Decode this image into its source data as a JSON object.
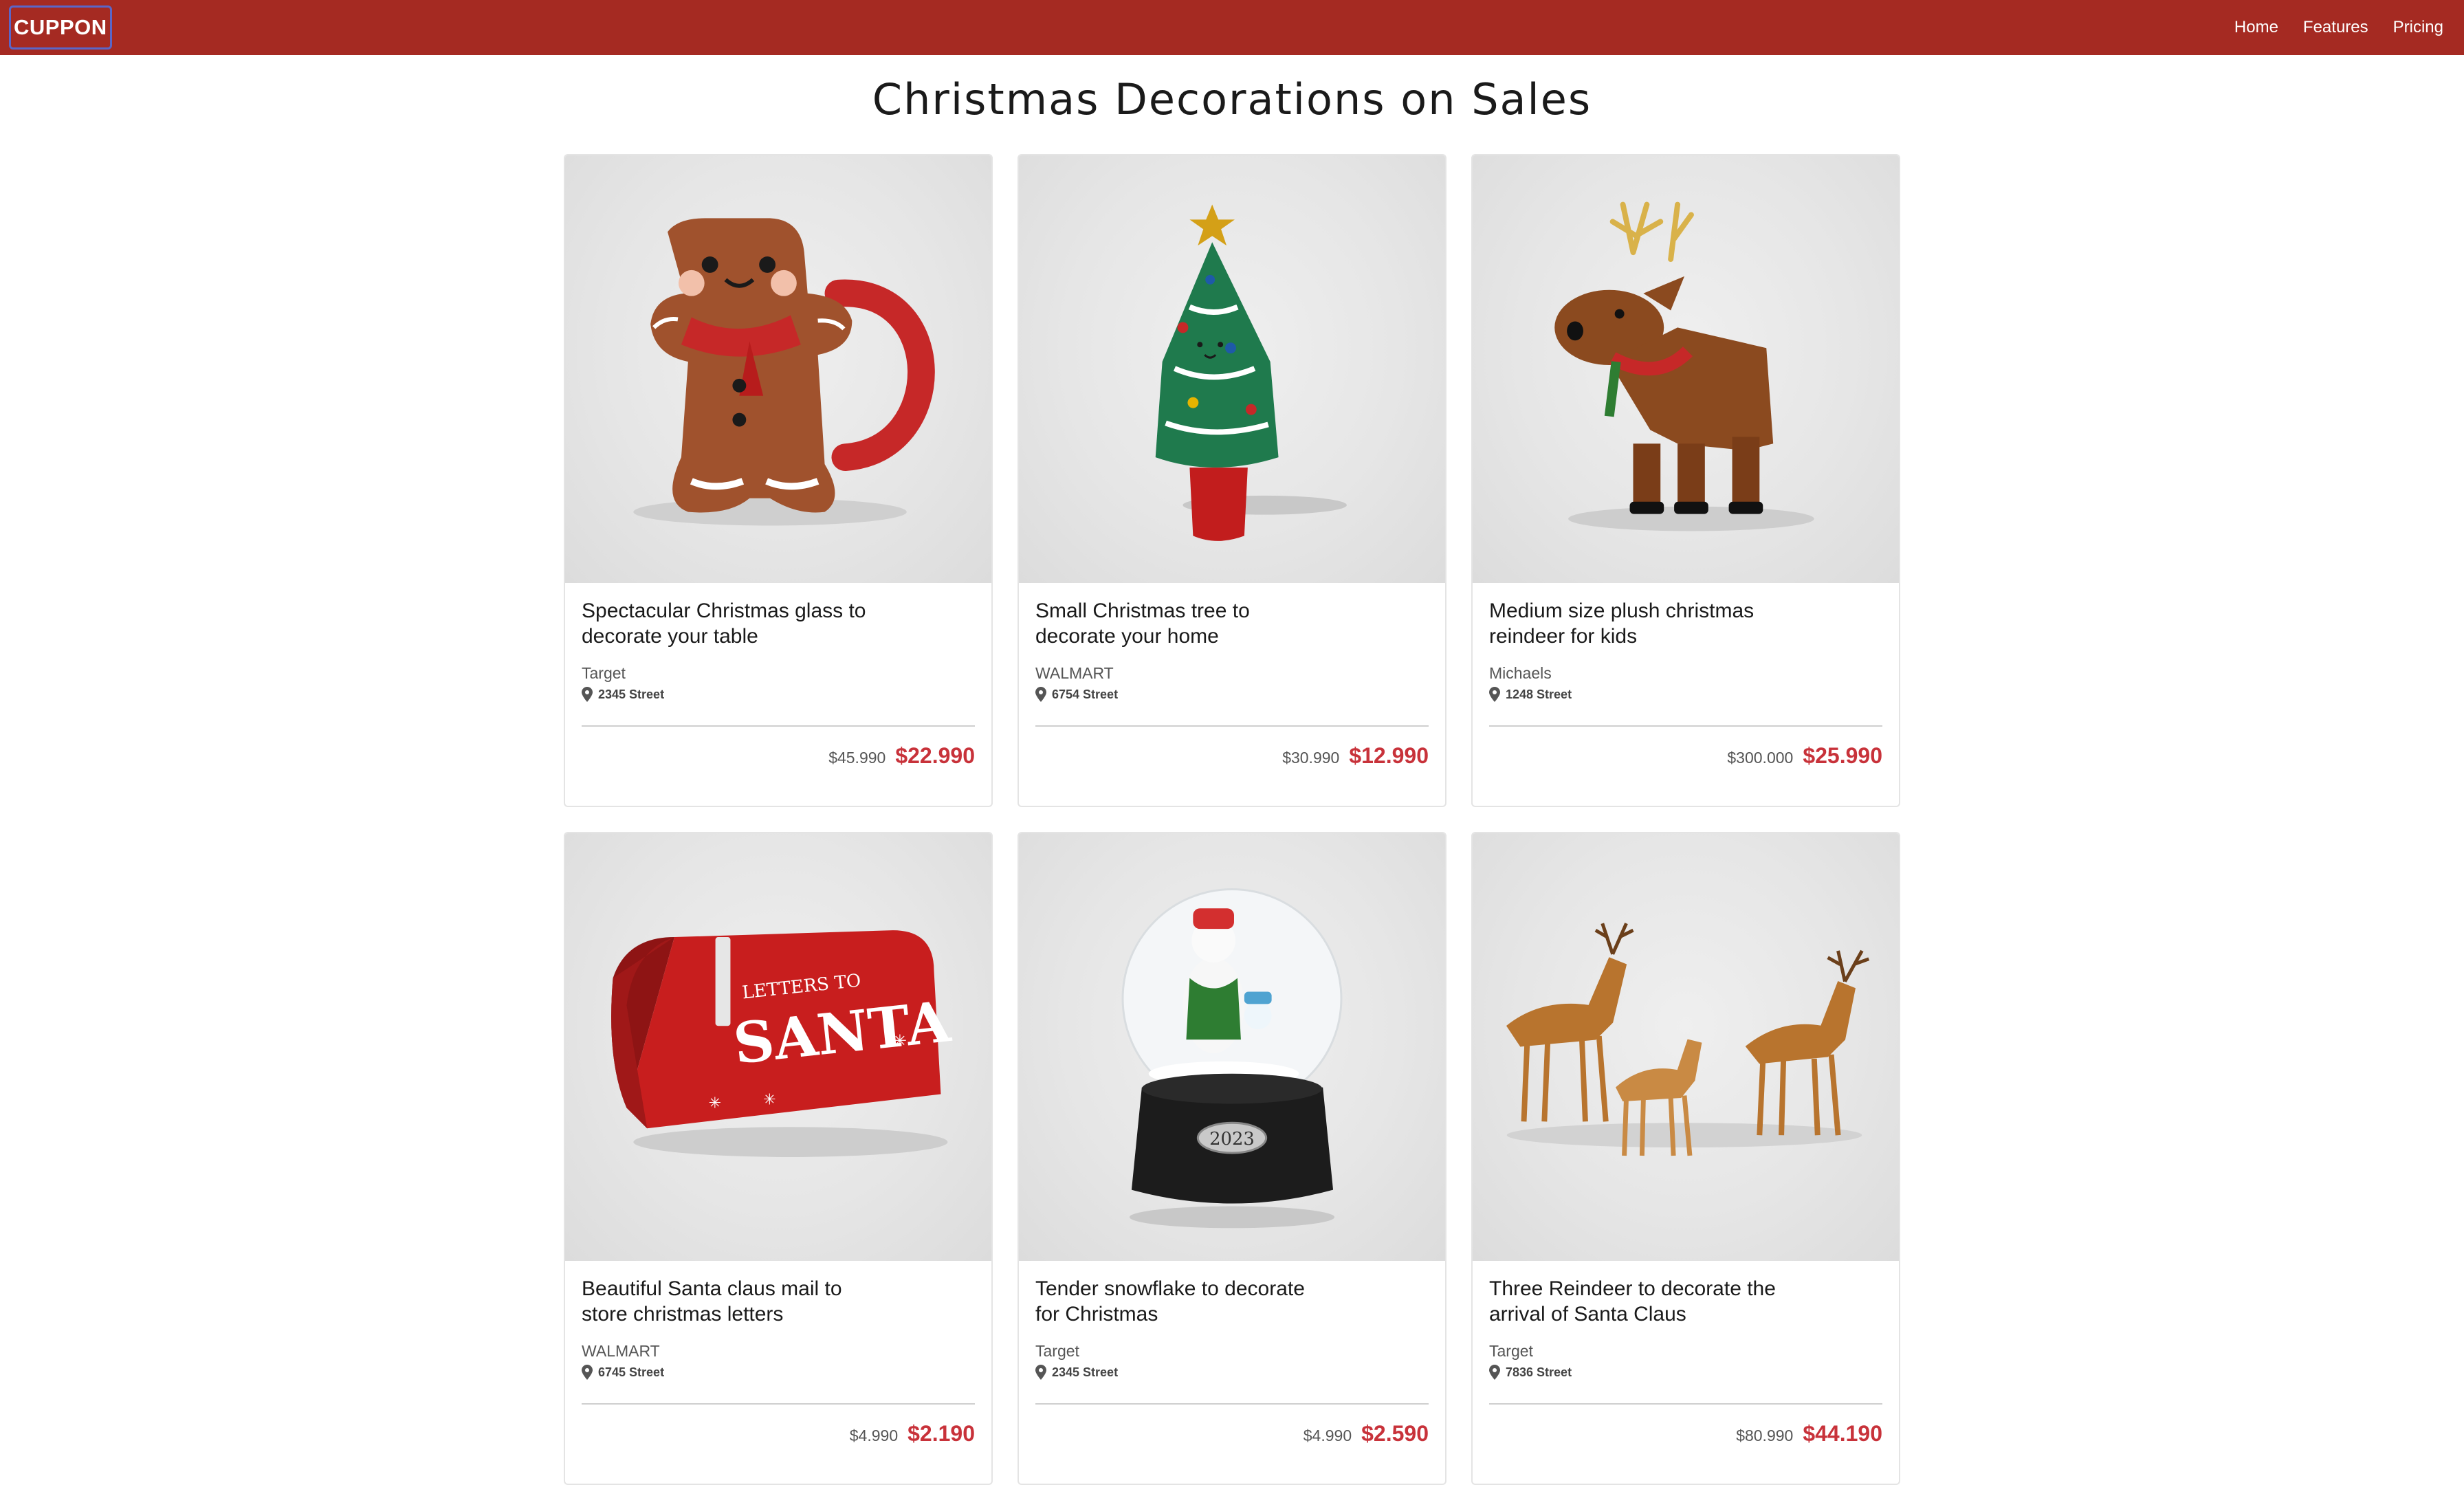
{
  "navbar": {
    "brand": "CUPPON",
    "links": [
      {
        "label": "Home"
      },
      {
        "label": "Features"
      },
      {
        "label": "Pricing"
      }
    ]
  },
  "page": {
    "title": "Christmas Decorations on Sales"
  },
  "products": [
    {
      "title": "Spectacular Christmas glass to decorate your table",
      "store": "Target",
      "address": "2345 Street",
      "old_price": "$45.990",
      "new_price": "$22.990",
      "image_icon": "gingerbread-mug"
    },
    {
      "title": "Small Christmas tree to decorate your home",
      "store": "WALMART",
      "address": "6754 Street",
      "old_price": "$30.990",
      "new_price": "$12.990",
      "image_icon": "christmas-tree"
    },
    {
      "title": "Medium size plush christmas reindeer for kids",
      "store": "Michaels",
      "address": "1248 Street",
      "old_price": "$300.000",
      "new_price": "$25.990",
      "image_icon": "plush-reindeer"
    },
    {
      "title": "Beautiful Santa claus mail to store christmas letters",
      "store": "WALMART",
      "address": "6745 Street",
      "old_price": "$4.990",
      "new_price": "$2.190",
      "image_icon": "santa-mailbox",
      "image_text": {
        "line1": "LETTERS TO",
        "line2": "SANTA"
      }
    },
    {
      "title": "Tender snowflake to decorate for Christmas",
      "store": "Target",
      "address": "2345 Street",
      "old_price": "$4.990",
      "new_price": "$2.590",
      "image_icon": "snow-globe",
      "image_text": {
        "year": "2023"
      }
    },
    {
      "title": "Three Reindeer to decorate the arrival of Santa Claus",
      "store": "Target",
      "address": "7836 Street",
      "old_price": "$80.990",
      "new_price": "$44.190",
      "image_icon": "three-reindeer"
    }
  ],
  "colors": {
    "navbar": "#a52a22",
    "sale_price": "#c8323a",
    "brand_border": "#5a66c8"
  }
}
